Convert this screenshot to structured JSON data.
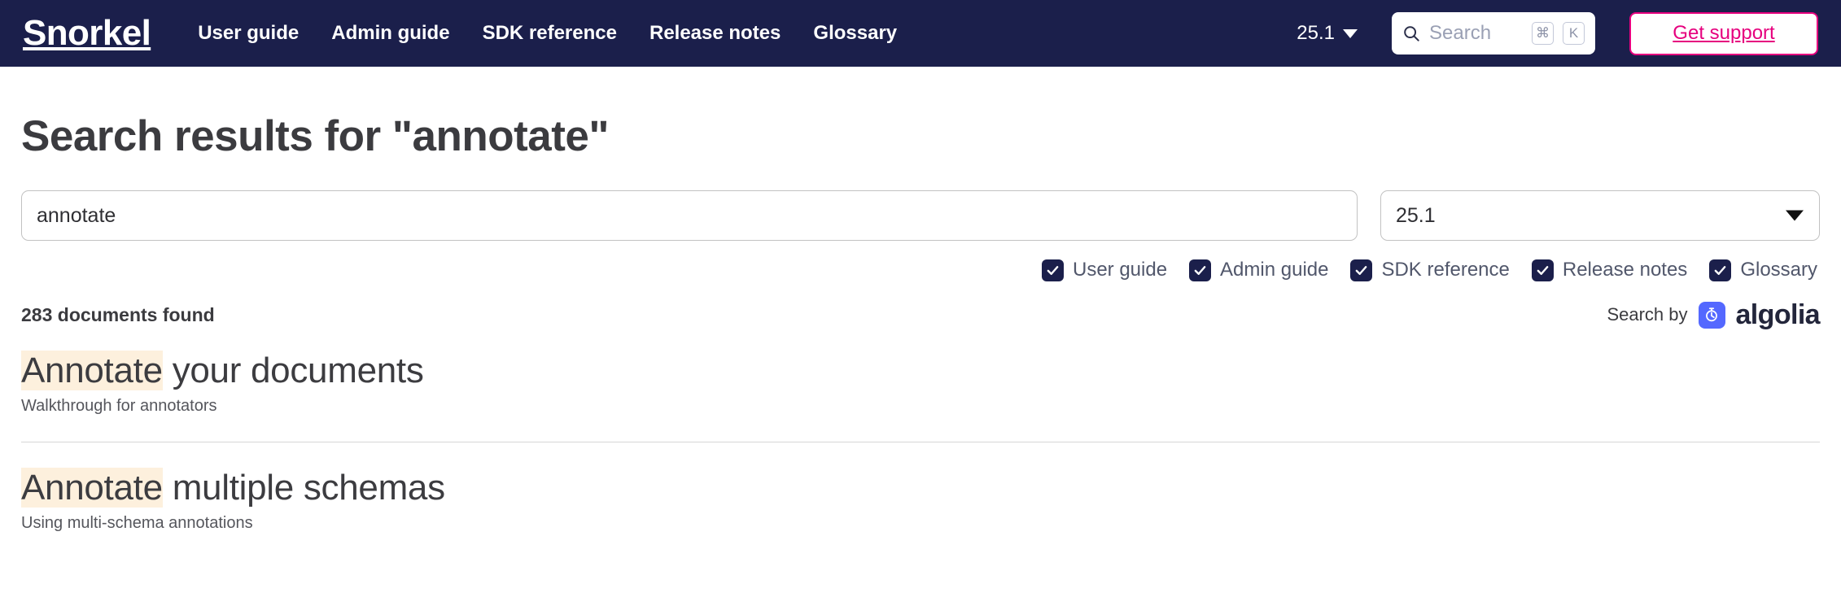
{
  "navbar": {
    "brand": "Snorkel",
    "links": [
      {
        "label": "User guide",
        "name": "nav-link-user-guide"
      },
      {
        "label": "Admin guide",
        "name": "nav-link-admin-guide"
      },
      {
        "label": "SDK reference",
        "name": "nav-link-sdk-reference"
      },
      {
        "label": "Release notes",
        "name": "nav-link-release-notes"
      },
      {
        "label": "Glossary",
        "name": "nav-link-glossary"
      }
    ],
    "version": "25.1",
    "search": {
      "placeholder": "Search",
      "icon": "search-icon",
      "kbd_modifier": "⌘",
      "kbd_key": "K"
    },
    "support_label": "Get support",
    "colors": {
      "background": "#1b1f4b",
      "accent_pink": "#e6007e",
      "text": "#ffffff"
    }
  },
  "page": {
    "title": "Search results for \"annotate\""
  },
  "search_form": {
    "query_value": "annotate",
    "query_placeholder": "annotate",
    "version_selected": "25.1",
    "version_options": [
      "25.1"
    ]
  },
  "filters": [
    {
      "label": "User guide",
      "checked": true,
      "name": "filter-user-guide"
    },
    {
      "label": "Admin guide",
      "checked": true,
      "name": "filter-admin-guide"
    },
    {
      "label": "SDK reference",
      "checked": true,
      "name": "filter-sdk-reference"
    },
    {
      "label": "Release notes",
      "checked": true,
      "name": "filter-release-notes"
    },
    {
      "label": "Glossary",
      "checked": true,
      "name": "filter-glossary"
    }
  ],
  "meta": {
    "documents_found": "283 documents found",
    "search_by_label": "Search by",
    "provider": "algolia",
    "provider_mark_icon": "algolia-stopwatch-icon",
    "provider_color": "#5468ff"
  },
  "results": [
    {
      "highlight": "Annotate",
      "rest": " your documents",
      "subtitle": "Walkthrough for annotators"
    },
    {
      "highlight": "Annotate",
      "rest": " multiple schemas",
      "subtitle": "Using multi-schema annotations"
    }
  ]
}
